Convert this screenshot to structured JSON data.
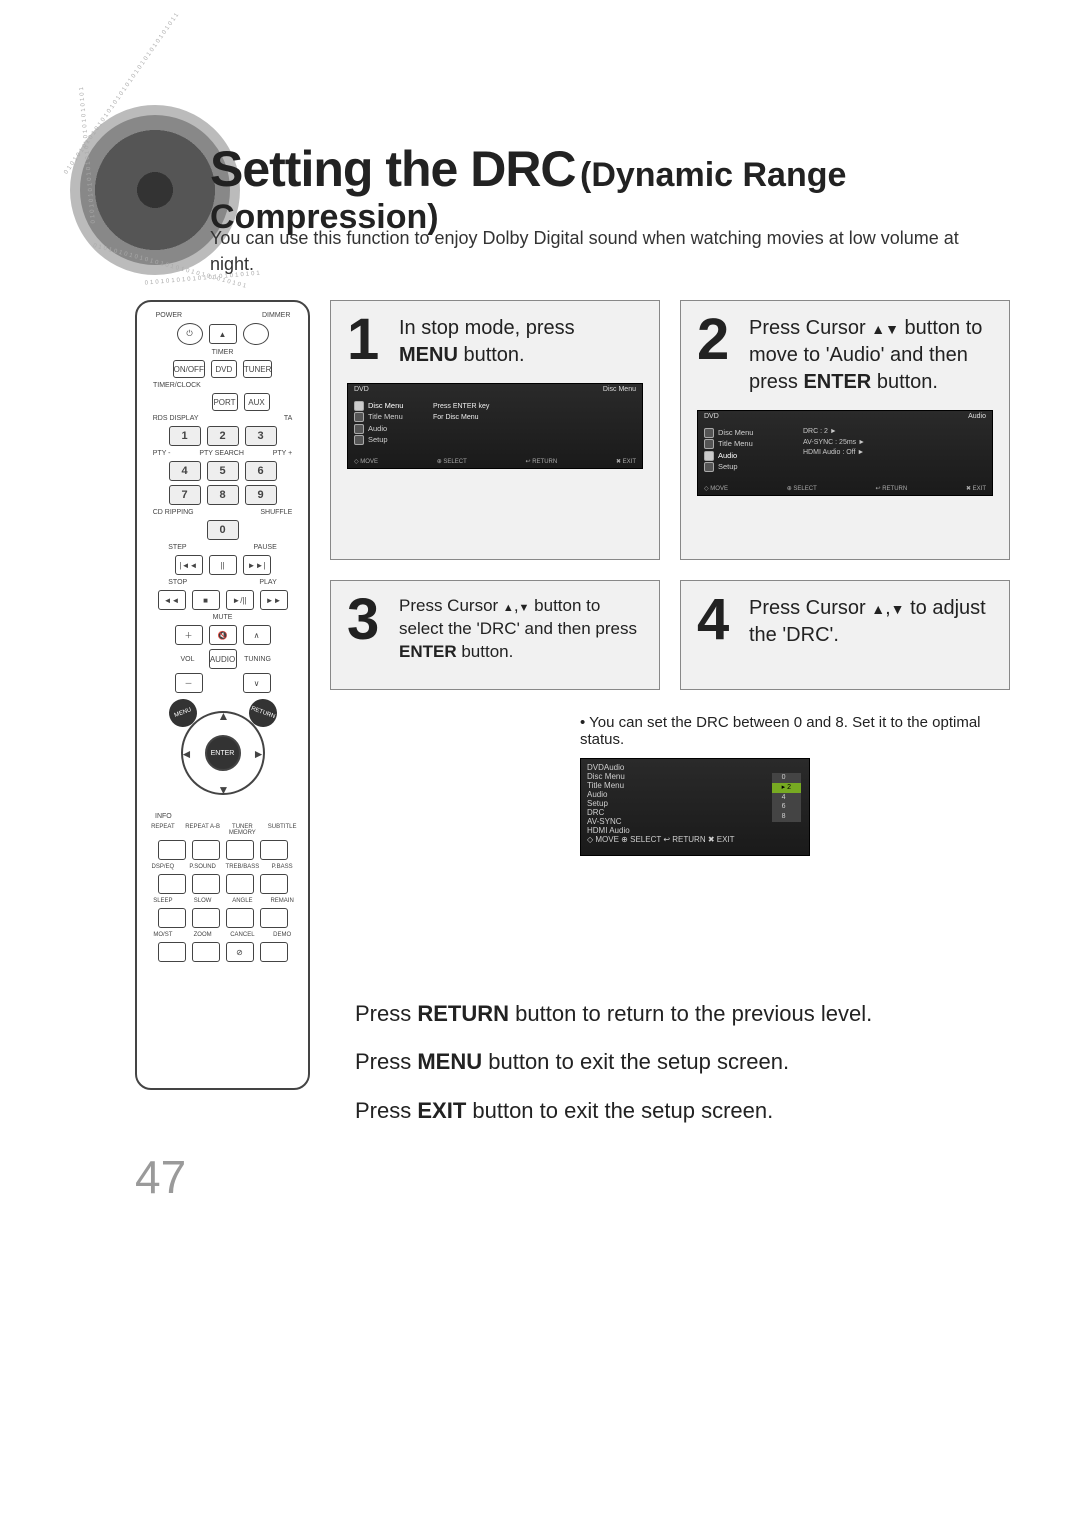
{
  "title": {
    "main": "Setting the DRC",
    "sub": "(Dynamic Range Compression)"
  },
  "subtitle": "You can use this function to enjoy Dolby Digital sound when watching movies at low volume at night.",
  "page_number": "47",
  "remote": {
    "top_labels": {
      "power": "POWER",
      "dimmer": "DIMMER"
    },
    "eject_icon": "▲",
    "power_icon": "⏻",
    "row_timer": "TIMER",
    "row1": {
      "onoff": "ON/OFF",
      "dvd": "DVD",
      "tuner": "TUNER"
    },
    "row_timerclock": "TIMER/CLOCK",
    "row2": {
      "port": "PORT",
      "aux": "AUX"
    },
    "rds_display": "RDS DISPLAY",
    "ta": "TA",
    "keypad": [
      "1",
      "2",
      "3",
      "4",
      "5",
      "6",
      "7",
      "8",
      "9",
      "0"
    ],
    "pty_labels": {
      "minus": "PTY -",
      "search": "PTY SEARCH",
      "plus": "PTY +"
    },
    "cd_ripping": "CD RIPPING",
    "shuffle": "SHUFFLE",
    "transport_labels": {
      "step": "STEP",
      "pause": "PAUSE",
      "stop": "STOP",
      "play": "PLAY"
    },
    "transport_icons": {
      "prev": "|◄◄",
      "pause": "||",
      "next": "►►|",
      "rew": "◄◄",
      "stop": "■",
      "playpause": "►/||",
      "ff": "►►"
    },
    "mute": "MUTE",
    "vol": "VOL",
    "audio": "AUDIO",
    "tuning": "TUNING",
    "menu": "MENU",
    "return": "RETURN",
    "enter": "ENTER",
    "info": "INFO",
    "row_a": {
      "repeat": "REPEAT",
      "repeat_ab": "REPEAT A-B",
      "tuner_memory": "TUNER MEMORY",
      "subtitle": "SUBTITLE"
    },
    "row_b": {
      "dspeq": "DSP/EQ",
      "psound": "P.SOUND",
      "trebbass": "TREB/BASS",
      "pbass": "P.BASS"
    },
    "row_c": {
      "sleep": "SLEEP",
      "slow": "SLOW",
      "angle": "ANGLE",
      "remain": "REMAIN"
    },
    "row_d": {
      "most": "MO/ST",
      "zoom": "ZOOM",
      "cancel": "CANCEL",
      "demo": "DEMO"
    },
    "cancel_icon": "⊘"
  },
  "steps": {
    "s1": {
      "num": "1",
      "line1": "In stop mode, press",
      "menu_word": "MENU",
      "line2": "  button."
    },
    "s2": {
      "num": "2",
      "line1_a": "Press Cursor ",
      "line1_b": " button to move to 'Audio' and then press ",
      "enter_word": "ENTER",
      "line1_c": " button."
    },
    "s3": {
      "num": "3",
      "line_a": "Press Cursor ",
      "line_b": " button to select the 'DRC' and then press ",
      "enter_word": "ENTER",
      "line_c": " button."
    },
    "s4": {
      "num": "4",
      "line_a": "Press Cursor ",
      "line_b": " to adjust the 'DRC'."
    }
  },
  "step4_note": "You can set the DRC between 0 and 8. Set it to the optimal status.",
  "osd": {
    "label_dvd": "DVD",
    "label_discmenu_top": "Disc Menu",
    "label_audio_top": "Audio",
    "items": {
      "disc_menu": "Disc Menu",
      "title_menu": "Title Menu",
      "audio": "Audio",
      "setup": "Setup"
    },
    "msg_line1": "Press ENTER key",
    "msg_line2": "For Disc Menu",
    "right_drc": "DRC",
    "right_avsync": "AV-SYNC",
    "right_hdmi": "HDMI Audio",
    "val_drc": ": 2",
    "val_avsync": ": 25ms",
    "val_hdmi": ": Off",
    "slider_vals": [
      "0",
      "2",
      "4",
      "6",
      "8"
    ],
    "foot_move": "MOVE",
    "foot_select": "SELECT",
    "foot_return": "RETURN",
    "foot_exit": "EXIT"
  },
  "bottom": {
    "l1_a": "Press ",
    "l1_b": "RETURN",
    "l1_c": " button to return to the previous level.",
    "l2_a": "Press ",
    "l2_b": "MENU",
    "l2_c": " button to exit the setup screen.",
    "l3_a": "Press ",
    "l3_b": "EXIT",
    "l3_c": " button to exit the setup screen."
  }
}
